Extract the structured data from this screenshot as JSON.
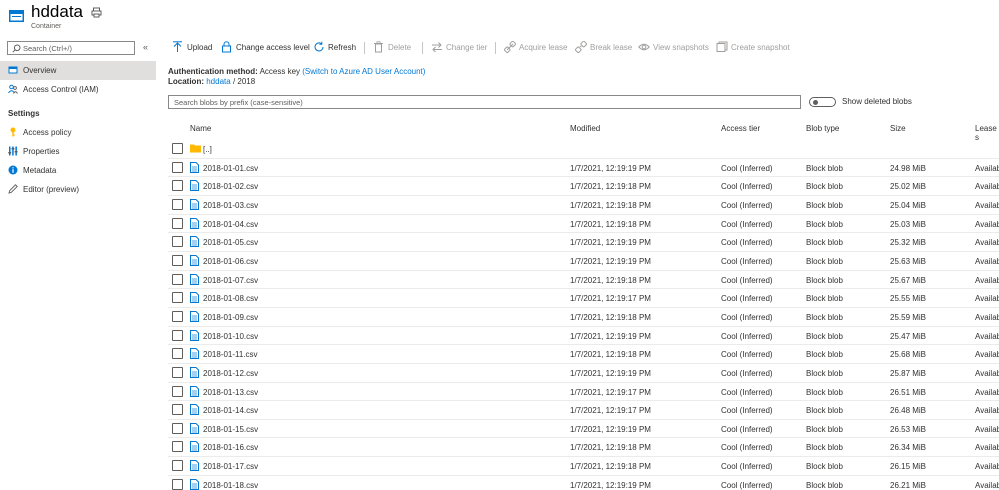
{
  "header": {
    "title": "hddata",
    "subtitle": "Container"
  },
  "sidebar": {
    "search_placeholder": "Search (Ctrl+/)",
    "collapse_glyph": "«",
    "items": [
      {
        "label": "Overview",
        "icon": "overview-icon"
      },
      {
        "label": "Access Control (IAM)",
        "icon": "people-icon"
      }
    ],
    "settings_heading": "Settings",
    "settings_items": [
      {
        "label": "Access policy",
        "icon": "key-icon"
      },
      {
        "label": "Properties",
        "icon": "properties-icon"
      },
      {
        "label": "Metadata",
        "icon": "info-icon"
      },
      {
        "label": "Editor (preview)",
        "icon": "pencil-icon"
      }
    ]
  },
  "toolbar": {
    "upload": "Upload",
    "change_access_level": "Change access level",
    "refresh": "Refresh",
    "delete": "Delete",
    "change_tier": "Change tier",
    "acquire_lease": "Acquire lease",
    "break_lease": "Break lease",
    "view_snapshots": "View snapshots",
    "create_snapshot": "Create snapshot"
  },
  "info": {
    "auth_label": "Authentication method:",
    "auth_value": "Access key",
    "auth_link": "(Switch to Azure AD User Account)",
    "location_label": "Location:",
    "location_link": "hddata",
    "location_sep": "/",
    "location_folder": "2018"
  },
  "blob_search_placeholder": "Search blobs by prefix (case-sensitive)",
  "show_deleted_label": "Show deleted blobs",
  "table": {
    "columns": {
      "name": "Name",
      "modified": "Modified",
      "tier": "Access tier",
      "type": "Blob type",
      "size": "Size",
      "lease": "Lease s"
    },
    "parent_row": "[..]",
    "rows": [
      {
        "name": "2018-01-01.csv",
        "modified": "1/7/2021, 12:19:19 PM",
        "tier": "Cool (Inferred)",
        "type": "Block blob",
        "size": "24.98 MiB",
        "lease": "Availab"
      },
      {
        "name": "2018-01-02.csv",
        "modified": "1/7/2021, 12:19:18 PM",
        "tier": "Cool (Inferred)",
        "type": "Block blob",
        "size": "25.02 MiB",
        "lease": "Availab"
      },
      {
        "name": "2018-01-03.csv",
        "modified": "1/7/2021, 12:19:18 PM",
        "tier": "Cool (Inferred)",
        "type": "Block blob",
        "size": "25.04 MiB",
        "lease": "Availab"
      },
      {
        "name": "2018-01-04.csv",
        "modified": "1/7/2021, 12:19:18 PM",
        "tier": "Cool (Inferred)",
        "type": "Block blob",
        "size": "25.03 MiB",
        "lease": "Availab"
      },
      {
        "name": "2018-01-05.csv",
        "modified": "1/7/2021, 12:19:19 PM",
        "tier": "Cool (Inferred)",
        "type": "Block blob",
        "size": "25.32 MiB",
        "lease": "Availab"
      },
      {
        "name": "2018-01-06.csv",
        "modified": "1/7/2021, 12:19:19 PM",
        "tier": "Cool (Inferred)",
        "type": "Block blob",
        "size": "25.63 MiB",
        "lease": "Availab"
      },
      {
        "name": "2018-01-07.csv",
        "modified": "1/7/2021, 12:19:18 PM",
        "tier": "Cool (Inferred)",
        "type": "Block blob",
        "size": "25.67 MiB",
        "lease": "Availab"
      },
      {
        "name": "2018-01-08.csv",
        "modified": "1/7/2021, 12:19:17 PM",
        "tier": "Cool (Inferred)",
        "type": "Block blob",
        "size": "25.55 MiB",
        "lease": "Availab"
      },
      {
        "name": "2018-01-09.csv",
        "modified": "1/7/2021, 12:19:18 PM",
        "tier": "Cool (Inferred)",
        "type": "Block blob",
        "size": "25.59 MiB",
        "lease": "Availab"
      },
      {
        "name": "2018-01-10.csv",
        "modified": "1/7/2021, 12:19:19 PM",
        "tier": "Cool (Inferred)",
        "type": "Block blob",
        "size": "25.47 MiB",
        "lease": "Availab"
      },
      {
        "name": "2018-01-11.csv",
        "modified": "1/7/2021, 12:19:18 PM",
        "tier": "Cool (Inferred)",
        "type": "Block blob",
        "size": "25.68 MiB",
        "lease": "Availab"
      },
      {
        "name": "2018-01-12.csv",
        "modified": "1/7/2021, 12:19:19 PM",
        "tier": "Cool (Inferred)",
        "type": "Block blob",
        "size": "25.87 MiB",
        "lease": "Availab"
      },
      {
        "name": "2018-01-13.csv",
        "modified": "1/7/2021, 12:19:17 PM",
        "tier": "Cool (Inferred)",
        "type": "Block blob",
        "size": "26.51 MiB",
        "lease": "Availab"
      },
      {
        "name": "2018-01-14.csv",
        "modified": "1/7/2021, 12:19:17 PM",
        "tier": "Cool (Inferred)",
        "type": "Block blob",
        "size": "26.48 MiB",
        "lease": "Availab"
      },
      {
        "name": "2018-01-15.csv",
        "modified": "1/7/2021, 12:19:19 PM",
        "tier": "Cool (Inferred)",
        "type": "Block blob",
        "size": "26.53 MiB",
        "lease": "Availab"
      },
      {
        "name": "2018-01-16.csv",
        "modified": "1/7/2021, 12:19:18 PM",
        "tier": "Cool (Inferred)",
        "type": "Block blob",
        "size": "26.34 MiB",
        "lease": "Availab"
      },
      {
        "name": "2018-01-17.csv",
        "modified": "1/7/2021, 12:19:18 PM",
        "tier": "Cool (Inferred)",
        "type": "Block blob",
        "size": "26.15 MiB",
        "lease": "Availab"
      },
      {
        "name": "2018-01-18.csv",
        "modified": "1/7/2021, 12:19:19 PM",
        "tier": "Cool (Inferred)",
        "type": "Block blob",
        "size": "26.21 MiB",
        "lease": "Availab"
      }
    ]
  },
  "colors": {
    "accent": "#0078d4",
    "folder": "#ffb900",
    "nav_active": "#e1dfdd"
  }
}
